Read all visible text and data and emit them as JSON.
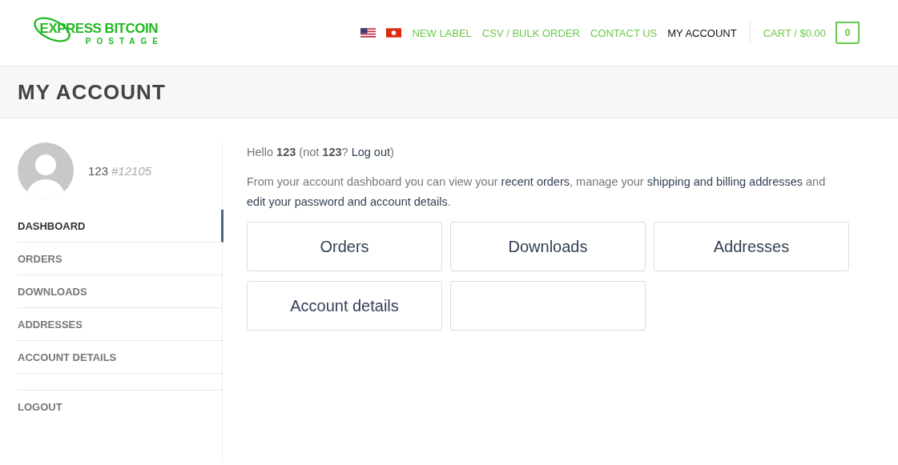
{
  "logo": {
    "name": "EXPRESS BITCOIN",
    "tagline": "POSTAGE"
  },
  "nav": [
    {
      "label": "NEW LABEL",
      "selected": false
    },
    {
      "label": "CSV / BULK ORDER",
      "selected": false
    },
    {
      "label": "CONTACT US",
      "selected": false
    },
    {
      "label": "MY ACCOUNT",
      "selected": true
    }
  ],
  "cart": {
    "label": "CART / $0.00",
    "count": "0"
  },
  "page_title": "MY ACCOUNT",
  "user": {
    "name": "123",
    "id": "#12105"
  },
  "sidebar": {
    "items": [
      {
        "label": "DASHBOARD",
        "selected": true
      },
      {
        "label": "ORDERS",
        "selected": false
      },
      {
        "label": "DOWNLOADS",
        "selected": false
      },
      {
        "label": "ADDRESSES",
        "selected": false
      },
      {
        "label": "ACCOUNT DETAILS",
        "selected": false
      }
    ],
    "logout": "LOGOUT"
  },
  "greeting": {
    "before": "Hello **123** (not **123**? ",
    "link": "Log out",
    "after": ")"
  },
  "intro": [
    {
      "kind": "text",
      "text": "From your account dashboard you can view your "
    },
    {
      "kind": "link",
      "text": "recent orders"
    },
    {
      "kind": "text",
      "text": ", manage your "
    },
    {
      "kind": "link",
      "text": "shipping and billing addresses"
    },
    {
      "kind": "text",
      "text": " and "
    },
    {
      "kind": "link",
      "text": "edit your password and account details"
    },
    {
      "kind": "text",
      "text": "."
    }
  ],
  "tiles": [
    {
      "kind": "link",
      "label": "Orders"
    },
    {
      "kind": "link",
      "label": "Downloads"
    },
    {
      "kind": "link",
      "label": "Addresses"
    },
    {
      "kind": "link",
      "label": "Account details"
    },
    {
      "kind": "blank"
    }
  ]
}
